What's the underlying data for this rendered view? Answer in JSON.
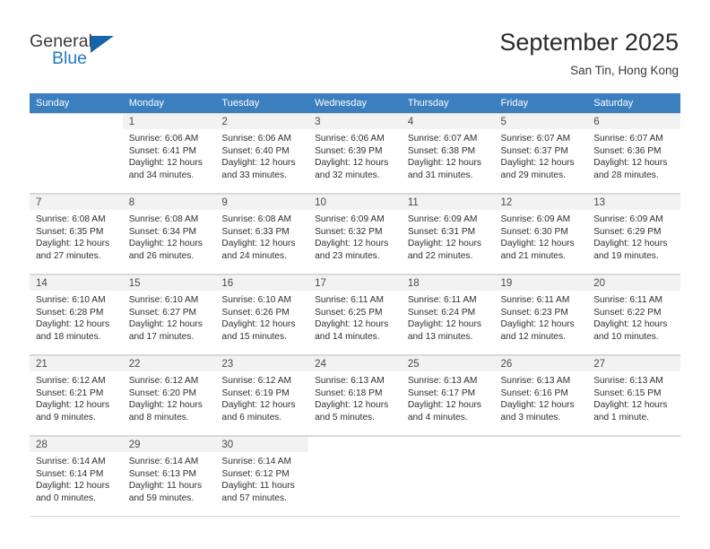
{
  "brand": {
    "name_top": "General",
    "name_bottom": "Blue",
    "accent_color": "#1565a8",
    "logo_icon": "flag-triangle-icon"
  },
  "header": {
    "title": "September 2025",
    "subtitle": "San Tin, Hong Kong"
  },
  "calendar": {
    "header_bg": "#3c7fbe",
    "header_text_color": "#ffffff",
    "daynum_bg": "#f2f2f2",
    "weekday_names": [
      "Sunday",
      "Monday",
      "Tuesday",
      "Wednesday",
      "Thursday",
      "Friday",
      "Saturday"
    ],
    "labels": {
      "sunrise": "Sunrise:",
      "sunset": "Sunset:",
      "daylight": "Daylight:"
    },
    "weeks": [
      [
        {
          "day": "",
          "sunrise": "",
          "sunset": "",
          "daylight": ""
        },
        {
          "day": "1",
          "sunrise": "Sunrise: 6:06 AM",
          "sunset": "Sunset: 6:41 PM",
          "daylight": "Daylight: 12 hours and 34 minutes."
        },
        {
          "day": "2",
          "sunrise": "Sunrise: 6:06 AM",
          "sunset": "Sunset: 6:40 PM",
          "daylight": "Daylight: 12 hours and 33 minutes."
        },
        {
          "day": "3",
          "sunrise": "Sunrise: 6:06 AM",
          "sunset": "Sunset: 6:39 PM",
          "daylight": "Daylight: 12 hours and 32 minutes."
        },
        {
          "day": "4",
          "sunrise": "Sunrise: 6:07 AM",
          "sunset": "Sunset: 6:38 PM",
          "daylight": "Daylight: 12 hours and 31 minutes."
        },
        {
          "day": "5",
          "sunrise": "Sunrise: 6:07 AM",
          "sunset": "Sunset: 6:37 PM",
          "daylight": "Daylight: 12 hours and 29 minutes."
        },
        {
          "day": "6",
          "sunrise": "Sunrise: 6:07 AM",
          "sunset": "Sunset: 6:36 PM",
          "daylight": "Daylight: 12 hours and 28 minutes."
        }
      ],
      [
        {
          "day": "7",
          "sunrise": "Sunrise: 6:08 AM",
          "sunset": "Sunset: 6:35 PM",
          "daylight": "Daylight: 12 hours and 27 minutes."
        },
        {
          "day": "8",
          "sunrise": "Sunrise: 6:08 AM",
          "sunset": "Sunset: 6:34 PM",
          "daylight": "Daylight: 12 hours and 26 minutes."
        },
        {
          "day": "9",
          "sunrise": "Sunrise: 6:08 AM",
          "sunset": "Sunset: 6:33 PM",
          "daylight": "Daylight: 12 hours and 24 minutes."
        },
        {
          "day": "10",
          "sunrise": "Sunrise: 6:09 AM",
          "sunset": "Sunset: 6:32 PM",
          "daylight": "Daylight: 12 hours and 23 minutes."
        },
        {
          "day": "11",
          "sunrise": "Sunrise: 6:09 AM",
          "sunset": "Sunset: 6:31 PM",
          "daylight": "Daylight: 12 hours and 22 minutes."
        },
        {
          "day": "12",
          "sunrise": "Sunrise: 6:09 AM",
          "sunset": "Sunset: 6:30 PM",
          "daylight": "Daylight: 12 hours and 21 minutes."
        },
        {
          "day": "13",
          "sunrise": "Sunrise: 6:09 AM",
          "sunset": "Sunset: 6:29 PM",
          "daylight": "Daylight: 12 hours and 19 minutes."
        }
      ],
      [
        {
          "day": "14",
          "sunrise": "Sunrise: 6:10 AM",
          "sunset": "Sunset: 6:28 PM",
          "daylight": "Daylight: 12 hours and 18 minutes."
        },
        {
          "day": "15",
          "sunrise": "Sunrise: 6:10 AM",
          "sunset": "Sunset: 6:27 PM",
          "daylight": "Daylight: 12 hours and 17 minutes."
        },
        {
          "day": "16",
          "sunrise": "Sunrise: 6:10 AM",
          "sunset": "Sunset: 6:26 PM",
          "daylight": "Daylight: 12 hours and 15 minutes."
        },
        {
          "day": "17",
          "sunrise": "Sunrise: 6:11 AM",
          "sunset": "Sunset: 6:25 PM",
          "daylight": "Daylight: 12 hours and 14 minutes."
        },
        {
          "day": "18",
          "sunrise": "Sunrise: 6:11 AM",
          "sunset": "Sunset: 6:24 PM",
          "daylight": "Daylight: 12 hours and 13 minutes."
        },
        {
          "day": "19",
          "sunrise": "Sunrise: 6:11 AM",
          "sunset": "Sunset: 6:23 PM",
          "daylight": "Daylight: 12 hours and 12 minutes."
        },
        {
          "day": "20",
          "sunrise": "Sunrise: 6:11 AM",
          "sunset": "Sunset: 6:22 PM",
          "daylight": "Daylight: 12 hours and 10 minutes."
        }
      ],
      [
        {
          "day": "21",
          "sunrise": "Sunrise: 6:12 AM",
          "sunset": "Sunset: 6:21 PM",
          "daylight": "Daylight: 12 hours and 9 minutes."
        },
        {
          "day": "22",
          "sunrise": "Sunrise: 6:12 AM",
          "sunset": "Sunset: 6:20 PM",
          "daylight": "Daylight: 12 hours and 8 minutes."
        },
        {
          "day": "23",
          "sunrise": "Sunrise: 6:12 AM",
          "sunset": "Sunset: 6:19 PM",
          "daylight": "Daylight: 12 hours and 6 minutes."
        },
        {
          "day": "24",
          "sunrise": "Sunrise: 6:13 AM",
          "sunset": "Sunset: 6:18 PM",
          "daylight": "Daylight: 12 hours and 5 minutes."
        },
        {
          "day": "25",
          "sunrise": "Sunrise: 6:13 AM",
          "sunset": "Sunset: 6:17 PM",
          "daylight": "Daylight: 12 hours and 4 minutes."
        },
        {
          "day": "26",
          "sunrise": "Sunrise: 6:13 AM",
          "sunset": "Sunset: 6:16 PM",
          "daylight": "Daylight: 12 hours and 3 minutes."
        },
        {
          "day": "27",
          "sunrise": "Sunrise: 6:13 AM",
          "sunset": "Sunset: 6:15 PM",
          "daylight": "Daylight: 12 hours and 1 minute."
        }
      ],
      [
        {
          "day": "28",
          "sunrise": "Sunrise: 6:14 AM",
          "sunset": "Sunset: 6:14 PM",
          "daylight": "Daylight: 12 hours and 0 minutes."
        },
        {
          "day": "29",
          "sunrise": "Sunrise: 6:14 AM",
          "sunset": "Sunset: 6:13 PM",
          "daylight": "Daylight: 11 hours and 59 minutes."
        },
        {
          "day": "30",
          "sunrise": "Sunrise: 6:14 AM",
          "sunset": "Sunset: 6:12 PM",
          "daylight": "Daylight: 11 hours and 57 minutes."
        },
        {
          "day": "",
          "sunrise": "",
          "sunset": "",
          "daylight": ""
        },
        {
          "day": "",
          "sunrise": "",
          "sunset": "",
          "daylight": ""
        },
        {
          "day": "",
          "sunrise": "",
          "sunset": "",
          "daylight": ""
        },
        {
          "day": "",
          "sunrise": "",
          "sunset": "",
          "daylight": ""
        }
      ]
    ]
  }
}
